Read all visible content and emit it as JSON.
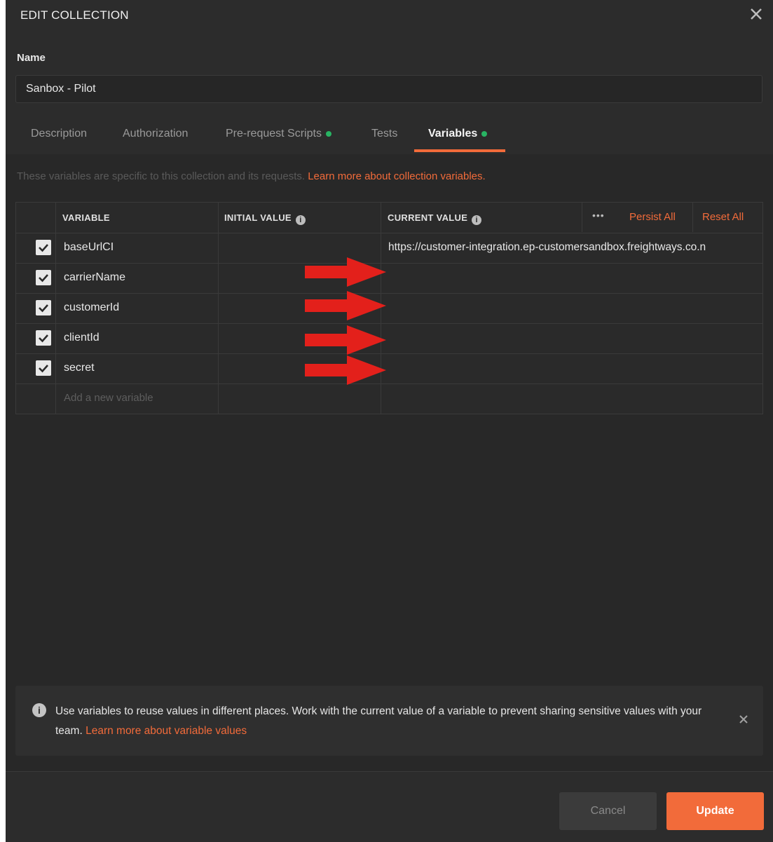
{
  "modal": {
    "title": "EDIT COLLECTION",
    "name_label": "Name",
    "name_value": "Sanbox - Pilot"
  },
  "tabs": [
    {
      "label": "Description",
      "active": false,
      "dot": false
    },
    {
      "label": "Authorization",
      "active": false,
      "dot": false
    },
    {
      "label": "Pre-request Scripts",
      "active": false,
      "dot": true
    },
    {
      "label": "Tests",
      "active": false,
      "dot": false
    },
    {
      "label": "Variables",
      "active": true,
      "dot": true
    }
  ],
  "info": {
    "text": "These variables are specific to this collection and its requests.",
    "link": "Learn more about collection variables."
  },
  "table": {
    "headers": {
      "variable": "VARIABLE",
      "initial": "INITIAL VALUE",
      "current": "CURRENT VALUE",
      "more": "•••",
      "persist_all": "Persist All",
      "reset_all": "Reset All"
    },
    "rows": [
      {
        "checked": true,
        "variable": "baseUrlCI",
        "initial": "",
        "current": "https://customer-integration.ep-customersandbox.freightways.co.n"
      },
      {
        "checked": true,
        "variable": "carrierName",
        "initial": "",
        "current": ""
      },
      {
        "checked": true,
        "variable": "customerId",
        "initial": "",
        "current": ""
      },
      {
        "checked": true,
        "variable": "clientId",
        "initial": "",
        "current": ""
      },
      {
        "checked": true,
        "variable": "secret",
        "initial": "",
        "current": ""
      }
    ],
    "add_placeholder": "Add a new variable"
  },
  "notice": {
    "text": "Use variables to reuse values in different places. Work with the current value of a variable to prevent sharing sensitive values with your team.",
    "link": "Learn more about variable values"
  },
  "footer": {
    "cancel": "Cancel",
    "update": "Update"
  },
  "colors": {
    "accent": "#f26b3a",
    "success_dot": "#28b463",
    "arrow": "#e3201b",
    "background": "#2c2c2c"
  },
  "icons": {
    "close": "close-icon",
    "info": "info-icon",
    "check": "check-icon",
    "arrow": "red-arrow-annotation"
  }
}
